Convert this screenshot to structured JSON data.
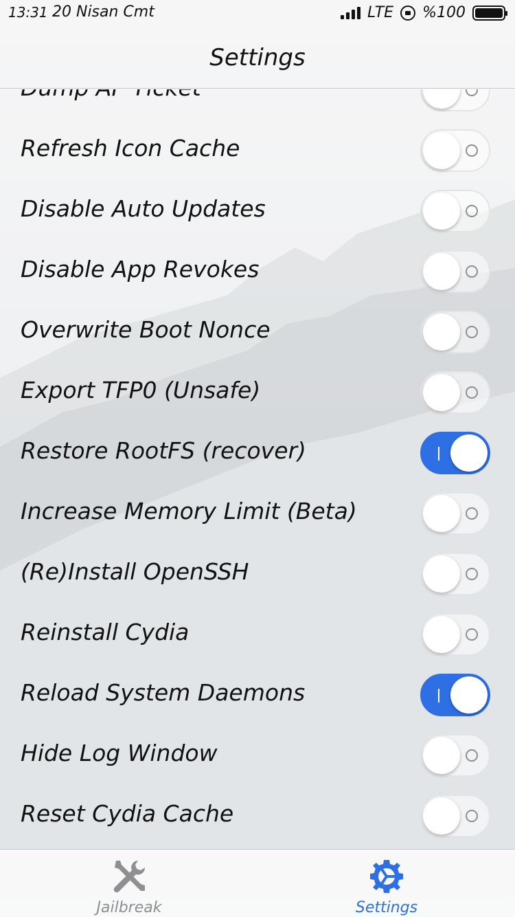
{
  "status_bar": {
    "time": "13:31",
    "date": "20 Nisan Cmt",
    "network": "LTE",
    "battery": "%100",
    "icons": [
      "signal-icon",
      "rotation-lock-icon",
      "battery-icon"
    ]
  },
  "nav": {
    "title": "Settings"
  },
  "settings": [
    {
      "label": "Dump AP Ticket",
      "on": false
    },
    {
      "label": "Refresh Icon Cache",
      "on": false
    },
    {
      "label": "Disable Auto Updates",
      "on": false
    },
    {
      "label": "Disable App Revokes",
      "on": false
    },
    {
      "label": "Overwrite Boot Nonce",
      "on": false
    },
    {
      "label": "Export TFP0 (Unsafe)",
      "on": false
    },
    {
      "label": "Restore RootFS (recover)",
      "on": true
    },
    {
      "label": "Increase Memory Limit (Beta)",
      "on": false
    },
    {
      "label": "(Re)Install OpenSSH",
      "on": false
    },
    {
      "label": "Reinstall Cydia",
      "on": false
    },
    {
      "label": "Reload System Daemons",
      "on": true
    },
    {
      "label": "Hide Log Window",
      "on": false
    },
    {
      "label": "Reset Cydia Cache",
      "on": false
    }
  ],
  "tabs": [
    {
      "label": "Jailbreak",
      "icon": "tools-icon",
      "active": false
    },
    {
      "label": "Settings",
      "icon": "gear-icon",
      "active": true
    }
  ],
  "colors": {
    "accent": "#2f6fe4",
    "inactive": "#8e8e93"
  }
}
